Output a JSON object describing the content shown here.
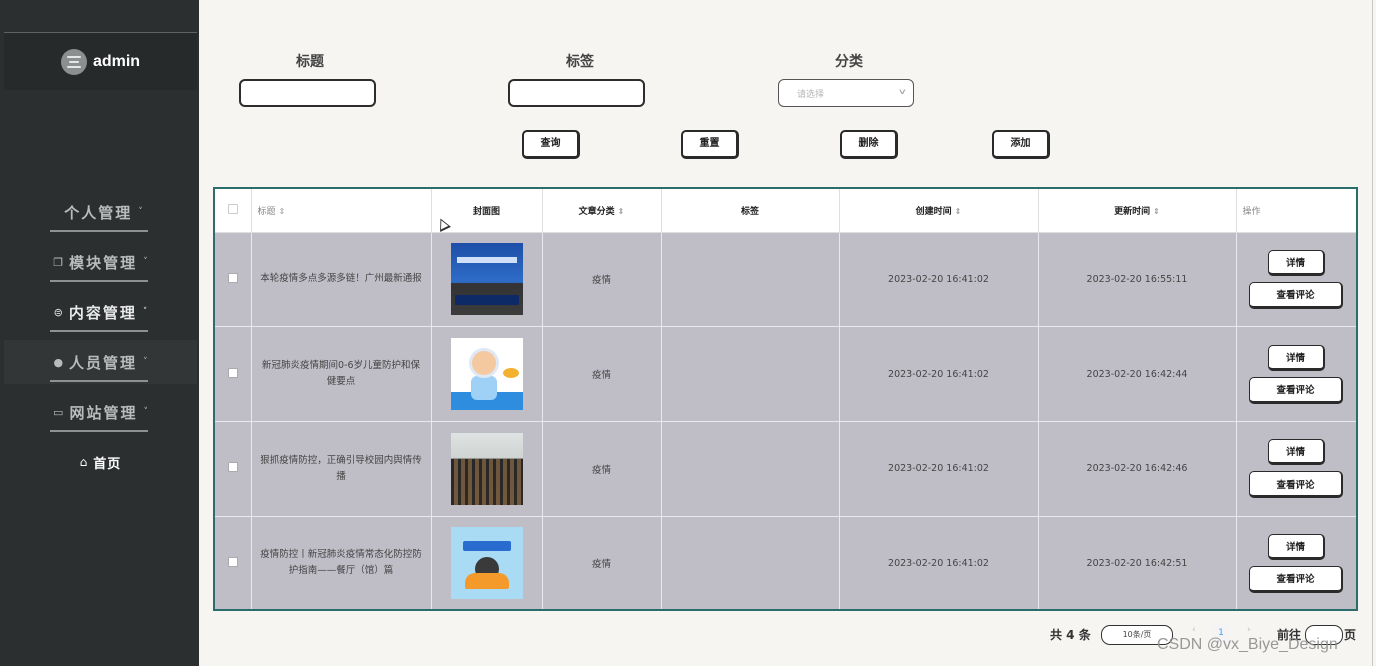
{
  "sidebar": {
    "user": {
      "name": "admin",
      "avatar_icon": "avatar-icon"
    },
    "menu": [
      {
        "label": "个人管理",
        "icon": "",
        "caret": "˅"
      },
      {
        "label": "模块管理",
        "icon": "❐",
        "caret": "˅"
      },
      {
        "label": "内容管理",
        "icon": "⊜",
        "caret": "˅"
      },
      {
        "label": "人员管理",
        "icon": "●",
        "caret": "˅"
      },
      {
        "label": "网站管理",
        "icon": "▭",
        "caret": "˅"
      }
    ],
    "home": {
      "label": "首页",
      "icon": "⌂"
    }
  },
  "filters": {
    "title_label": "标题",
    "tag_label": "标签",
    "category_label": "分类",
    "category_placeholder": "请选择",
    "title_value": "",
    "tag_value": ""
  },
  "actions": {
    "search": "查询",
    "reset": "重置",
    "delete": "删除",
    "add": "添加"
  },
  "table": {
    "headers": {
      "title": "标题",
      "cover": "封面图",
      "category": "文章分类",
      "tag": "标签",
      "created": "创建时间",
      "updated": "更新时间",
      "ops": "操作"
    },
    "sort_icon": "⇕",
    "row_buttons": {
      "detail": "详情",
      "comments": "查看评论"
    },
    "rows": [
      {
        "title": "本轮疫情多点多源多链！广州最新通报",
        "category": "疫情",
        "tag": "",
        "created": "2023-02-20 16:41:02",
        "updated": "2023-02-20 16:55:11"
      },
      {
        "title": "新冠肺炎疫情期间0-6岁儿童防护和保健要点",
        "category": "疫情",
        "tag": "",
        "created": "2023-02-20 16:41:02",
        "updated": "2023-02-20 16:42:44"
      },
      {
        "title": "狠抓疫情防控，正确引导校园内舆情传播",
        "category": "疫情",
        "tag": "",
        "created": "2023-02-20 16:41:02",
        "updated": "2023-02-20 16:42:46"
      },
      {
        "title": "疫情防控丨新冠肺炎疫情常态化防控防护指南——餐厅（馆）篇",
        "category": "疫情",
        "tag": "",
        "created": "2023-02-20 16:41:02",
        "updated": "2023-02-20 16:42:51"
      }
    ]
  },
  "pagination": {
    "total": "共 4 条",
    "page_size": "10条/页",
    "prev": "‹",
    "current": "1",
    "next": "›",
    "goto_label": "前往",
    "page_label": "页"
  },
  "watermark": "CSDN @vx_Biye_Design"
}
